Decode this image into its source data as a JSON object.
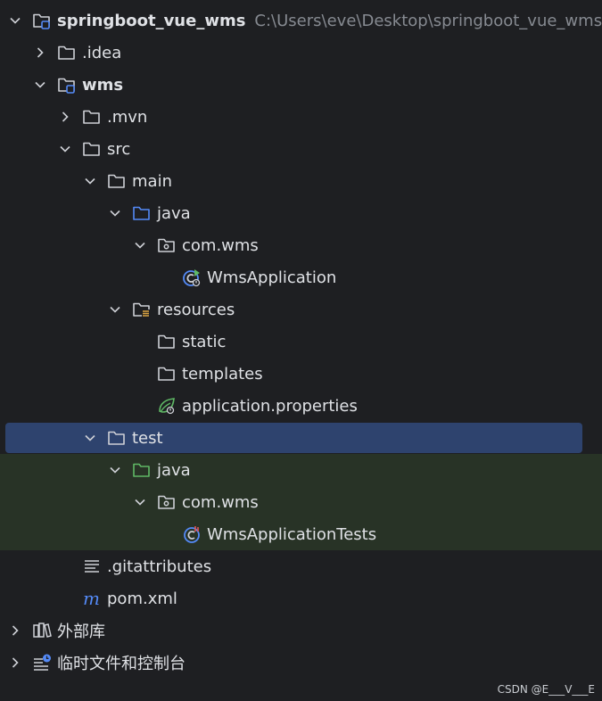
{
  "project": {
    "root_label": "springboot_vue_wms",
    "root_path": "C:\\Users\\eve\\Desktop\\springboot_vue_wms",
    "idea_label": ".idea",
    "wms_label": "wms",
    "mvn_label": ".mvn",
    "src_label": "src",
    "main_label": "main",
    "main_java_label": "java",
    "main_pkg_label": "com.wms",
    "app_class_label": "WmsApplication",
    "resources_label": "resources",
    "static_label": "static",
    "templates_label": "templates",
    "props_label": "application.properties",
    "test_label": "test",
    "test_java_label": "java",
    "test_pkg_label": "com.wms",
    "test_class_label": "WmsApplicationTests",
    "gitattr_label": ".gitattributes",
    "pom_label": "pom.xml"
  },
  "external_libs_label": "外部库",
  "scratches_label": "临时文件和控制台",
  "watermark": "CSDN @E___V___E",
  "colors": {
    "background": "#1e1f22",
    "selection": "#2e436e",
    "test_zone": "#283326",
    "folder": "#ced0d6",
    "module_blue": "#548af7",
    "source_blue": "#548af7",
    "test_green": "#5fb865",
    "text": "#dfe1e5",
    "path_gray": "#868a91"
  }
}
